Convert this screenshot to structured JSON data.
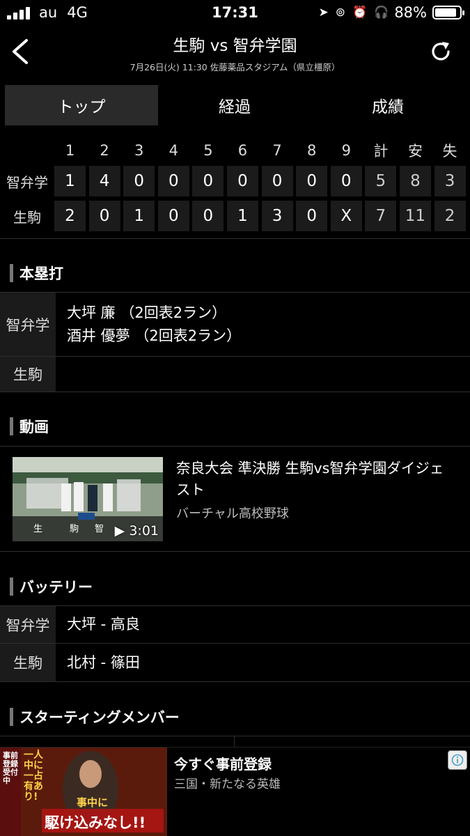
{
  "status_bar": {
    "carrier": "au",
    "network": "4G",
    "time": "17:31",
    "battery_percent": "88%",
    "battery_level": 0.88
  },
  "header": {
    "title": "生駒 vs 智弁学園",
    "subtitle": "7月26日(火) 11:30 佐藤薬品スタジアム（県立橿原）"
  },
  "tabs": [
    {
      "label": "トップ",
      "active": true
    },
    {
      "label": "経過",
      "active": false
    },
    {
      "label": "成績",
      "active": false
    }
  ],
  "scoreboard": {
    "columns": [
      "1",
      "2",
      "3",
      "4",
      "5",
      "6",
      "7",
      "8",
      "9",
      "計",
      "安",
      "失"
    ],
    "rows": [
      {
        "team": "智弁学",
        "cells": [
          "1",
          "4",
          "0",
          "0",
          "0",
          "0",
          "0",
          "0",
          "0",
          "5",
          "8",
          "3"
        ]
      },
      {
        "team": "生駒",
        "cells": [
          "2",
          "0",
          "1",
          "0",
          "0",
          "1",
          "3",
          "0",
          "X",
          "7",
          "11",
          "2"
        ]
      }
    ]
  },
  "home_runs": {
    "title": "本塁打",
    "rows": [
      {
        "team": "智弁学",
        "lines": [
          "大坪 廉 （2回表2ラン）",
          "酒井 優夢 （2回表2ラン）"
        ]
      },
      {
        "team": "生駒",
        "lines": []
      }
    ]
  },
  "video": {
    "section_title": "動画",
    "title": "奈良大会 準決勝 生駒vs智弁学園ダイジェスト",
    "channel": "バーチャル高校野球",
    "duration": "3:01",
    "scoreboard_text": [
      "生",
      "駒",
      "智"
    ]
  },
  "battery_section": {
    "title": "バッテリー",
    "rows": [
      {
        "team": "智弁学",
        "value": "大坪 - 高良"
      },
      {
        "team": "生駒",
        "value": "北村 - 篠田"
      }
    ]
  },
  "starting_members": {
    "title": "スターティングメンバー"
  },
  "ad": {
    "title": "今すぐ事前登録",
    "subtitle": "三国・新たなる英雄",
    "image_text": [
      "事前登録受付中",
      "一人中に一占有あり!",
      "事中に",
      "駆け込みなし!!"
    ]
  }
}
